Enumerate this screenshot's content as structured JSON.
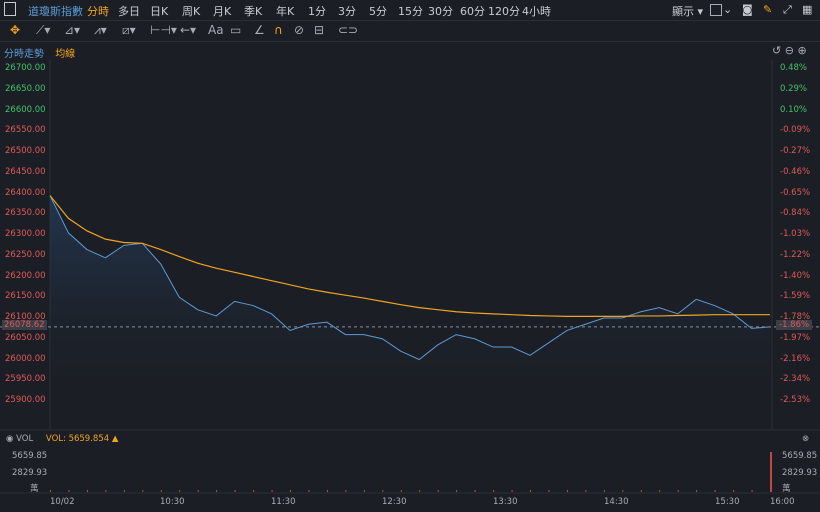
{
  "topbar": {
    "title": "道瓊斯指數",
    "tabs": [
      "分時",
      "多日",
      "日K",
      "周K",
      "月K",
      "季K",
      "年K",
      "1分",
      "3分",
      "5分",
      "15分",
      "30分",
      "60分",
      "120分",
      "4小時"
    ],
    "display_label": "顯示"
  },
  "legend": {
    "intraday": "分時走勢",
    "avg": "均線"
  },
  "price_axis": [
    "26700.00",
    "26650.00",
    "26600.00",
    "26550.00",
    "26500.00",
    "26450.00",
    "26400.00",
    "26350.00",
    "26300.00",
    "26250.00",
    "26200.00",
    "26150.00",
    "26100.00",
    "26050.00",
    "26000.00",
    "25950.00",
    "25900.00"
  ],
  "pct_axis": [
    "0.48%",
    "0.29%",
    "0.10%",
    "-0.09%",
    "-0.27%",
    "-0.46%",
    "-0.65%",
    "-0.84%",
    "-1.03%",
    "-1.22%",
    "-1.40%",
    "-1.59%",
    "-1.78%",
    "-1.97%",
    "-2.16%",
    "-2.34%",
    "-2.53%"
  ],
  "current": {
    "price": "26078.62",
    "pct": "-1.86%"
  },
  "volume": {
    "label": "VOL",
    "value_label": "VOL: 5659.854 ▲",
    "ticks": [
      "5659.85",
      "2829.93",
      "萬"
    ]
  },
  "x_axis": [
    "10/02",
    "10:30",
    "11:30",
    "12:30",
    "13:30",
    "14:30",
    "15:30",
    "16:00"
  ],
  "colors": {
    "line": "#5b9bd5",
    "avg": "#f0a41f",
    "up": "#44c26c",
    "down": "#e05a5a",
    "bg": "#1b1e24"
  },
  "chart_data": {
    "type": "line",
    "title": "",
    "x": [
      "09:30",
      "09:40",
      "09:50",
      "10:00",
      "10:10",
      "10:20",
      "10:30",
      "10:40",
      "10:50",
      "11:00",
      "11:10",
      "11:20",
      "11:30",
      "11:40",
      "11:50",
      "12:00",
      "12:10",
      "12:20",
      "12:30",
      "12:40",
      "12:50",
      "13:00",
      "13:10",
      "13:20",
      "13:30",
      "13:40",
      "13:50",
      "14:00",
      "14:10",
      "14:20",
      "14:30",
      "14:40",
      "14:50",
      "15:00",
      "15:10",
      "15:20",
      "15:30",
      "15:40",
      "15:50",
      "16:00"
    ],
    "series": [
      {
        "values": [
          26395,
          26305,
          26265,
          26245,
          26275,
          26280,
          26230,
          26150,
          26120,
          26105,
          26140,
          26130,
          26110,
          26070,
          26085,
          26090,
          26060,
          26060,
          26050,
          26020,
          26000,
          26035,
          26060,
          26050,
          26030,
          26030,
          26010,
          26040,
          26070,
          26085,
          26100,
          26100,
          26115,
          26125,
          26110,
          26145,
          26130,
          26110,
          26075,
          26078.62
        ]
      },
      {
        "values": [
          26395,
          26340,
          26310,
          26290,
          26282,
          26280,
          26265,
          26248,
          26232,
          26220,
          26210,
          26200,
          26190,
          26180,
          26170,
          26162,
          26155,
          26148,
          26140,
          26132,
          26125,
          26120,
          26115,
          26112,
          26110,
          26108,
          26106,
          26105,
          26104,
          26104,
          26104,
          26104,
          26105,
          26105,
          26106,
          26107,
          26108,
          26108,
          26108,
          26108
        ]
      }
    ],
    "ylim": [
      25900,
      26700
    ]
  }
}
